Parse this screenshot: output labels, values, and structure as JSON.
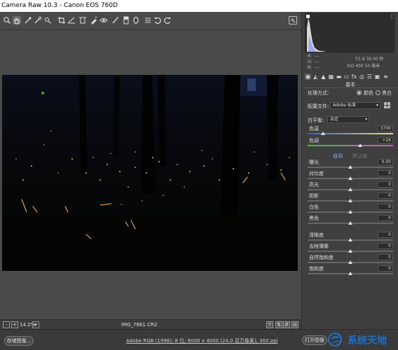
{
  "window": {
    "title": "Camera Raw 10.3 -  Canon EOS 760D"
  },
  "toolbar": {
    "tools": [
      {
        "name": "zoom-tool-icon",
        "glyph": "🔍"
      },
      {
        "name": "hand-tool-icon",
        "glyph": "✋"
      },
      {
        "name": "white-balance-tool-icon",
        "glyph": "⟋"
      },
      {
        "name": "color-sampler-tool-icon",
        "glyph": "⟋"
      },
      {
        "name": "targeted-adjustment-tool-icon",
        "glyph": "⊙"
      },
      {
        "name": "crop-tool-icon",
        "glyph": "⌗"
      },
      {
        "name": "straighten-tool-icon",
        "glyph": "⊿"
      },
      {
        "name": "transform-tool-icon",
        "glyph": "⌖"
      },
      {
        "name": "spot-removal-tool-icon",
        "glyph": "✎"
      },
      {
        "name": "red-eye-tool-icon",
        "glyph": "⊕"
      },
      {
        "name": "adjustment-brush-icon",
        "glyph": "✐"
      },
      {
        "name": "graduated-filter-icon",
        "glyph": "▮"
      },
      {
        "name": "radial-filter-icon",
        "glyph": "◯"
      },
      {
        "name": "preferences-icon",
        "glyph": "☰"
      },
      {
        "name": "rotate-left-icon",
        "glyph": "↺"
      },
      {
        "name": "rotate-right-icon",
        "glyph": "↻"
      }
    ]
  },
  "histogram": {
    "readout": {
      "r": "R:",
      "g": "G:",
      "b": "B:",
      "dash": "---",
      "exposure": "f/1.8    30.00 秒",
      "iso": "ISO 400   50 毫米"
    }
  },
  "panel": {
    "section_title": "基本",
    "process_label": "处理方式:",
    "color_label": "颜色",
    "bw_label": "黑白",
    "profile_label": "配置文件:",
    "profile_value": "Adobe 标准",
    "wb_label": "白平衡:",
    "wb_value": "自定",
    "temp_label": "色温",
    "temp_value": "3700",
    "tint_label": "色调",
    "tint_value": "+26",
    "auto_label": "自动",
    "default_label": "默认值",
    "sliders": [
      {
        "label": "曝光",
        "value": "0.00"
      },
      {
        "label": "对比度",
        "value": "0"
      },
      {
        "label": "高光",
        "value": "0"
      },
      {
        "label": "阴影",
        "value": "0"
      },
      {
        "label": "白色",
        "value": "0"
      },
      {
        "label": "黑色",
        "value": "0"
      },
      {
        "label": "清晰度",
        "value": "0"
      },
      {
        "label": "去除薄雾",
        "value": "0"
      },
      {
        "label": "自然饱和度",
        "value": "0"
      },
      {
        "label": "饱和度",
        "value": "0"
      }
    ]
  },
  "bottombar": {
    "zoom_out": "-",
    "zoom_in": "+",
    "zoom_value": "14.2%",
    "filename": "IMG_7861.CR2"
  },
  "footer": {
    "save_label": "存储图像...",
    "workflow": "Adobe RGB (1998); 8 位; 6000 x 4000 (24.0 百万像素); 300 ppi",
    "open_label": "打开图像"
  },
  "watermark": {
    "text": "系统天地"
  },
  "colors": {
    "accent": "#1f6fc9",
    "background": "#3f3f3f"
  }
}
